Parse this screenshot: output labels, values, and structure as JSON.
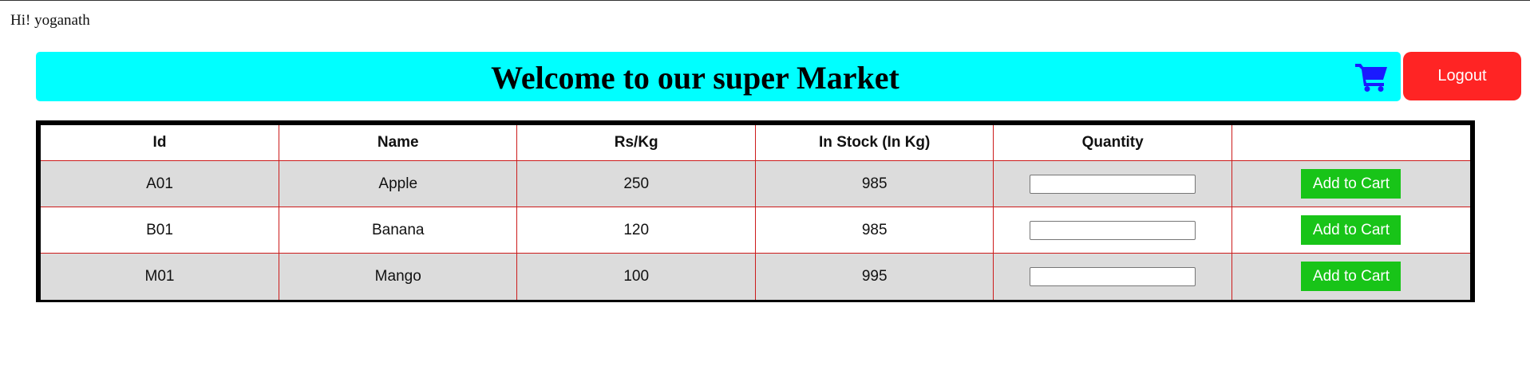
{
  "greeting": "Hi! yoganath",
  "banner": {
    "title": "Welcome to our super Market",
    "background_color": "#00ffff",
    "cart_icon": "shopping-cart-icon",
    "cart_icon_color": "#1a1aff"
  },
  "logout": {
    "label": "Logout",
    "color": "#ff2424"
  },
  "table": {
    "headers": [
      "Id",
      "Name",
      "Rs/Kg",
      "In Stock (In Kg)",
      "Quantity",
      ""
    ],
    "rows": [
      {
        "id": "A01",
        "name": "Apple",
        "price": "250",
        "stock": "985",
        "quantity": "",
        "action": "Add to Cart"
      },
      {
        "id": "B01",
        "name": "Banana",
        "price": "120",
        "stock": "985",
        "quantity": "",
        "action": "Add to Cart"
      },
      {
        "id": "M01",
        "name": "Mango",
        "price": "100",
        "stock": "995",
        "quantity": "",
        "action": "Add to Cart"
      }
    ],
    "border_color": "#cc1b1b",
    "add_button_color": "#18c418"
  }
}
